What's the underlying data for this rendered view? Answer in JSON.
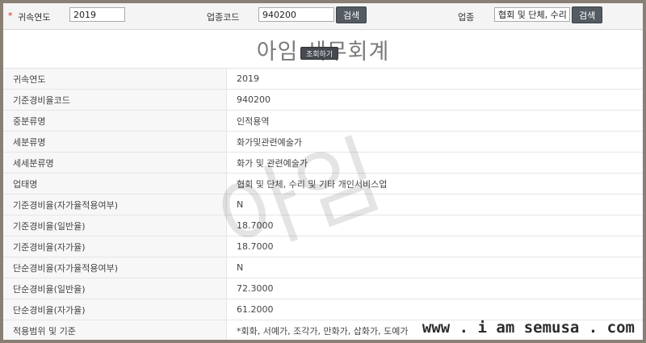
{
  "search": {
    "required_mark": "*",
    "year_label": "귀속연도",
    "year_value": "2019",
    "code_label": "업종코드",
    "code_value": "940200",
    "code_search_button": "검색",
    "industry_label": "업종",
    "industry_value": "협회 및 단체, 수리",
    "industry_search_button": "검색"
  },
  "title": {
    "brand": "아임 세무회계",
    "query_button": "조회하기"
  },
  "table": {
    "rows": [
      {
        "key": "귀속연도",
        "value": "2019"
      },
      {
        "key": "기준경비율코드",
        "value": "940200"
      },
      {
        "key": "중분류명",
        "value": "인적용역"
      },
      {
        "key": "세분류명",
        "value": "화가및관련예술가"
      },
      {
        "key": "세세분류명",
        "value": "화가 및 관련예술가"
      },
      {
        "key": "업태명",
        "value": "협회 및 단체, 수리 및 기타 개인서비스업"
      },
      {
        "key": "기준경비율(자가율적용여부)",
        "value": "N"
      },
      {
        "key": "기준경비율(일반율)",
        "value": "18.7000"
      },
      {
        "key": "기준경비율(자가율)",
        "value": "18.7000"
      },
      {
        "key": "단순경비율(자가율적용여부)",
        "value": "N"
      },
      {
        "key": "단순경비율(일반율)",
        "value": "72.3000"
      },
      {
        "key": "단순경비율(자가율)",
        "value": "61.2000"
      },
      {
        "key": "적용범위 및 기준",
        "value": "*회화, 서예가, 조각가, 만화가, 삽화가, 도예가"
      }
    ]
  },
  "watermark_text": "아임",
  "footer": {
    "site": "www . i am semusa . com"
  },
  "colors": {
    "frame": "#8a7f74",
    "button": "#555b63",
    "required": "#dd2222"
  }
}
